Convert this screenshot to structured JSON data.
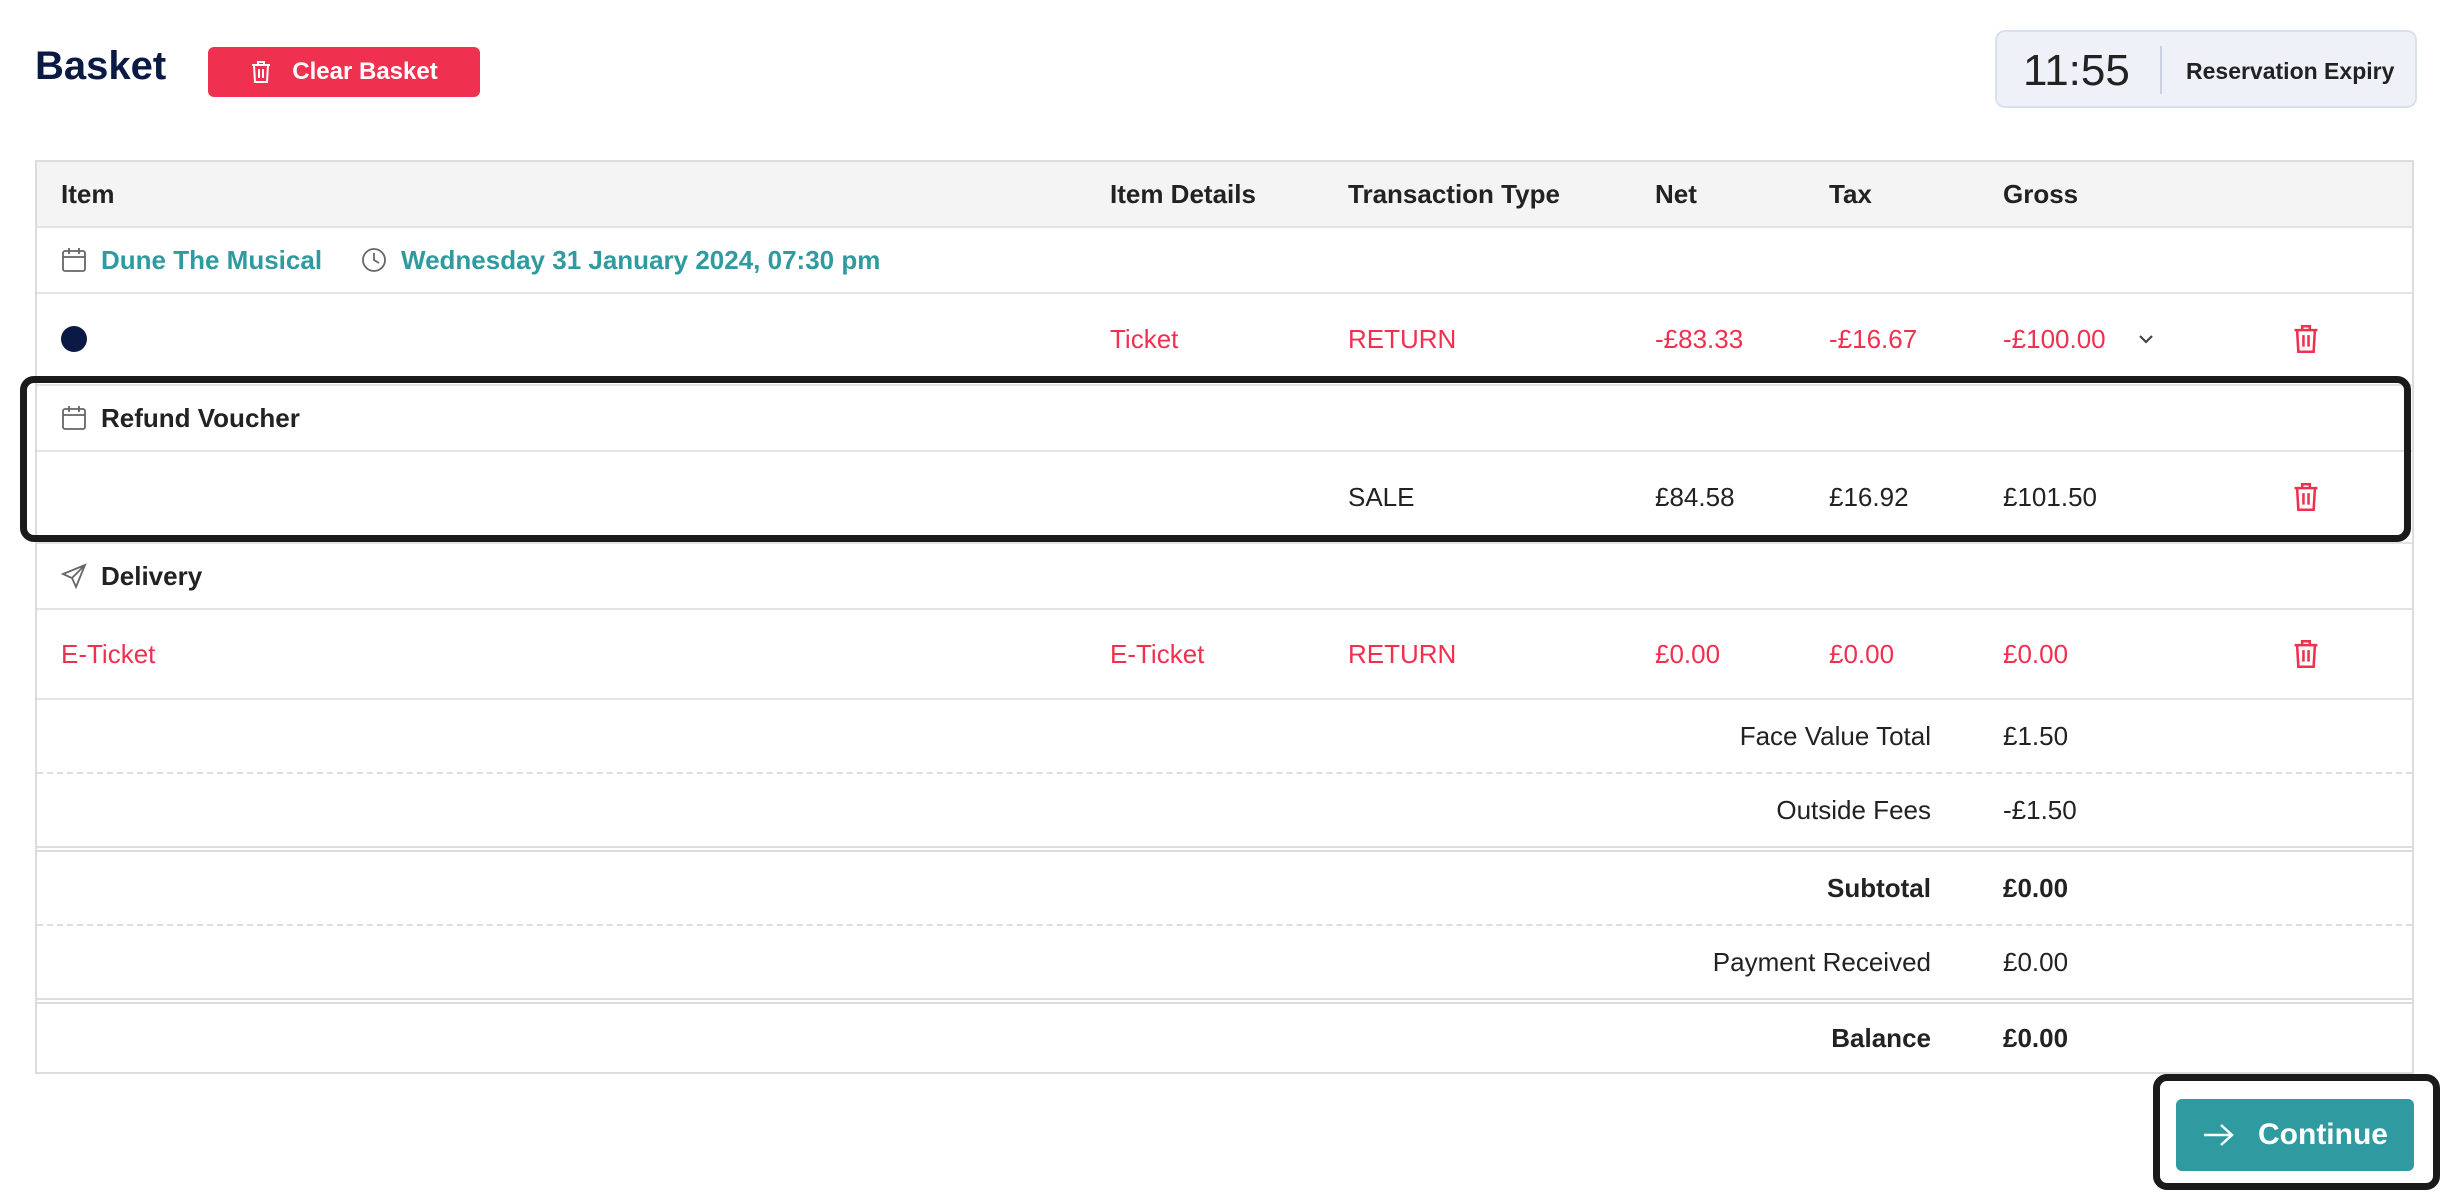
{
  "header": {
    "title": "Basket",
    "clear_label": "Clear Basket",
    "timer_value": "11:55",
    "timer_label": "Reservation Expiry"
  },
  "table": {
    "columns": [
      "Item",
      "Item Details",
      "Transaction Type",
      "Net",
      "Tax",
      "Gross"
    ],
    "event": {
      "name": "Dune The Musical",
      "datetime": "Wednesday 31 January 2024, 07:30 pm"
    },
    "ticket_row": {
      "details": "Ticket",
      "type": "RETURN",
      "net": "-£83.33",
      "tax": "-£16.67",
      "gross": "-£100.00"
    },
    "voucher": {
      "title": "Refund Voucher",
      "type": "SALE",
      "net": "£84.58",
      "tax": "£16.92",
      "gross": "£101.50"
    },
    "delivery": {
      "title": "Delivery",
      "item": "E-Ticket",
      "details": "E-Ticket",
      "type": "RETURN",
      "net": "£0.00",
      "tax": "£0.00",
      "gross": "£0.00"
    },
    "totals": {
      "face_value_label": "Face Value Total",
      "face_value": "£1.50",
      "outside_fees_label": "Outside Fees",
      "outside_fees": "-£1.50",
      "subtotal_label": "Subtotal",
      "subtotal": "£0.00",
      "payment_label": "Payment Received",
      "payment": "£0.00",
      "balance_label": "Balance",
      "balance": "£0.00"
    }
  },
  "actions": {
    "continue_label": "Continue"
  },
  "colors": {
    "accent": "#2f9ba0",
    "danger": "#f0304f",
    "navy": "#0b1a45"
  }
}
